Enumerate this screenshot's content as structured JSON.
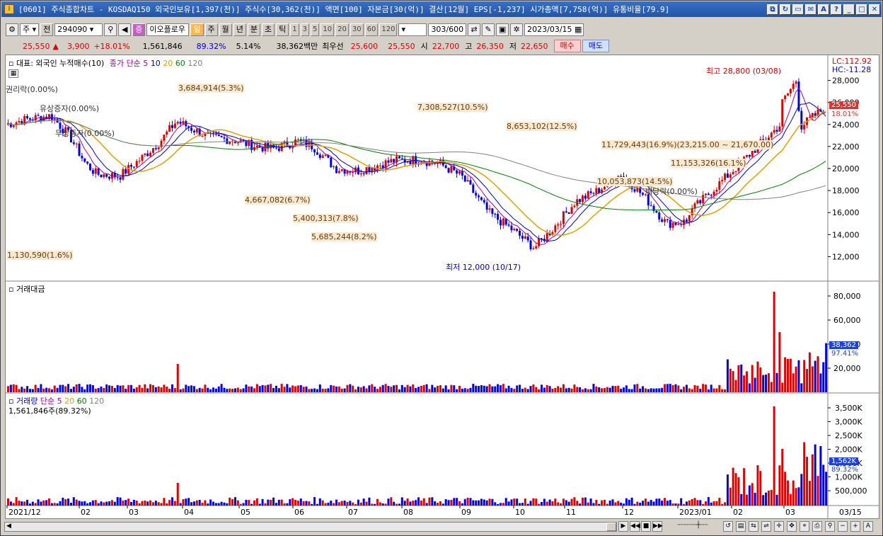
{
  "window": {
    "title": "[0601] 주식종합차트 - KOSDAQ150 외국인보유[1,397(천)] 주식수[30,362(천)] 액면[100] 자본금[30(억)] 결산[12월] EPS[-1,237] 시가총액[7,758(억)] 유통비율[79.9]",
    "buttons": [
      "⧉",
      "↻",
      "▭",
      "✉",
      "A",
      "?",
      "_",
      "□",
      "✕"
    ]
  },
  "toolbar": {
    "period_select": "주",
    "prev_label": "전",
    "code": "294090",
    "stock_name": "이오플로우",
    "badge_credit": "증",
    "tab_il": "일",
    "tabs": [
      "주",
      "월",
      "년",
      "분",
      "초",
      "틱"
    ],
    "numbers": [
      "1",
      "3",
      "5",
      "10",
      "20",
      "30",
      "60",
      "120"
    ],
    "count": "303",
    "count_total": "/600",
    "date": "2023/03/15"
  },
  "quote": {
    "price": "25,550",
    "arrow": "▲",
    "change": "3,900",
    "change_pct": "+18.01%",
    "volume": "1,561,846",
    "volume_pct": "89.32%",
    "turnover_pct": "5.14%",
    "amount": "38,362백만",
    "best_label": "최우선",
    "ask": "25,600",
    "bid": "25,550",
    "open_label": "시",
    "open": "22,700",
    "high_label": "고",
    "high": "26,350",
    "low_label": "저",
    "low": "22,650",
    "buy_label": "매수",
    "sell_label": "매도"
  },
  "price_pane": {
    "legend_left": "대표: 외국인 누적매수(10)",
    "legend_ma": "종가 단순 5",
    "ma_periods": [
      "10",
      "20",
      "60",
      "120"
    ],
    "ma_colors": [
      "#a000a0",
      "#0000c0",
      "#e0a000",
      "#008000",
      "#808080"
    ],
    "lc": "LC:112.92",
    "hc": "HC:-11.28",
    "y_ticks": [
      "28,000",
      "26,000",
      "24,000",
      "22,000",
      "20,000",
      "18,000",
      "16,000",
      "14,000",
      "12,000"
    ],
    "price_tag": "25,550",
    "pct_tag": "18.01%",
    "high_note": "최고 28,800 (03/08)",
    "low_note": "최저 12,000 (10/17)",
    "events": [
      "권리락(0.00%)",
      "유상증자(0.00%)",
      "무상증자(0.00%)",
      "배당락(0.00%)"
    ],
    "volume_profile": [
      "3,684,914(5.3%)",
      "7,308,527(10.5%)",
      "8,653,102(12.5%)",
      "11,729,443(16.9%)(23,215.00 ~ 21,670.00)",
      "11,153,326(16.1%)",
      "10,053,873(14.5%)",
      "4,667,082(6.7%)",
      "5,400,313(7.8%)",
      "5,685,244(8.2%)",
      "1,130,590(1.6%)"
    ]
  },
  "amount_pane": {
    "legend": "거래대금",
    "y_ticks": [
      "80,000",
      "60,000",
      "40,000",
      "20,000"
    ],
    "tag": "38,362",
    "tag_pct": "97.41%"
  },
  "volume_pane": {
    "legend": "거래량",
    "legend_ma": "단순 5",
    "ma_periods": [
      "20",
      "60",
      "120"
    ],
    "sub_legend": "1,561,846주(89.32%)",
    "y_ticks": [
      "3,500K",
      "3,000K",
      "2,500K",
      "2,000K",
      "1,500K",
      "1,000K",
      "500,000"
    ],
    "tag": "1,562K",
    "tag_pct": "89.32%"
  },
  "x_axis": {
    "labels": [
      "2021/12",
      "02",
      "03",
      "04",
      "05",
      "06",
      "07",
      "08",
      "09",
      "10",
      "11",
      "12",
      "2023/01",
      "02",
      "03"
    ],
    "right_label": "03/15"
  },
  "colors": {
    "up": "#e00000",
    "down": "#0000e0",
    "profile": "#f7e9d4",
    "price_tag": "#e03030",
    "volume_tag": "#2040e0"
  }
}
